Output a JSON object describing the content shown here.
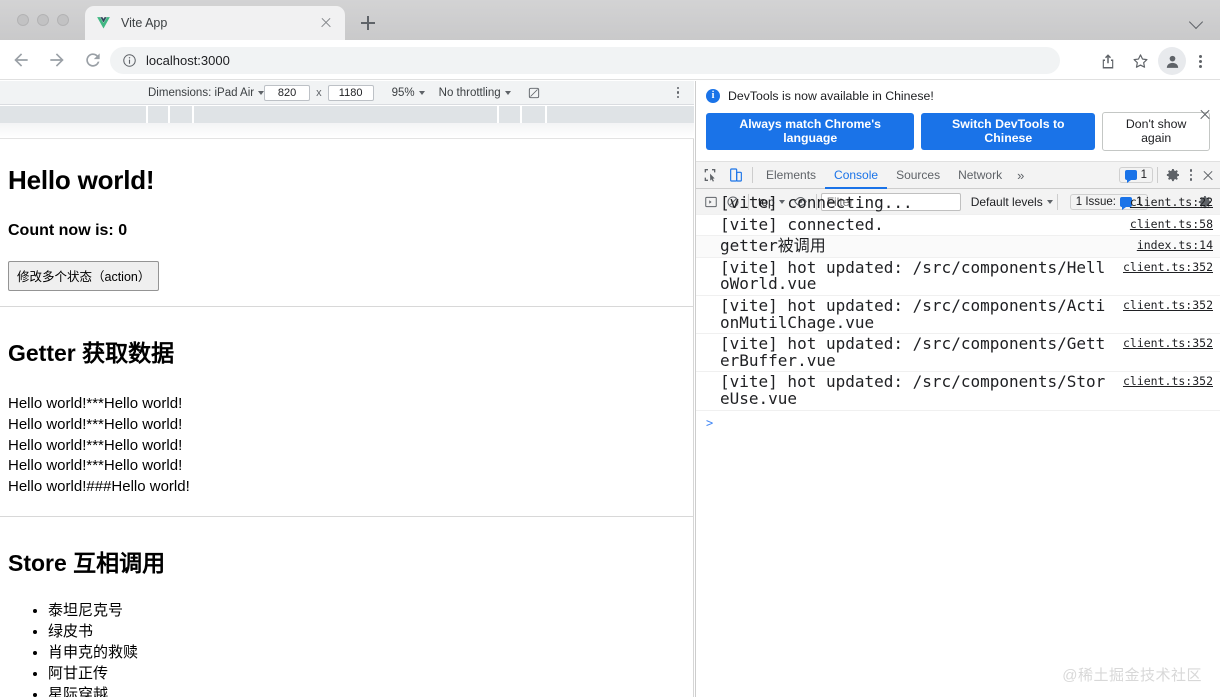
{
  "browser": {
    "tab": {
      "title": "Vite App",
      "favicon": "vue-logo-icon"
    },
    "new_tab_label": "+",
    "omnibox": {
      "url": "localhost:3000",
      "security_icon": "info-circle-icon"
    },
    "nav": {
      "back": "back-arrow-icon",
      "forward": "forward-arrow-icon",
      "reload": "reload-icon"
    },
    "actions": {
      "share": "share-icon",
      "bookmark": "star-icon",
      "profile": "avatar-icon",
      "menu": "kebab-menu-icon"
    }
  },
  "device_toolbar": {
    "dimensions_label": "Dimensions: iPad Air",
    "width": "820",
    "height": "1180",
    "multiply": "x",
    "zoom": "95%",
    "throttling": "No throttling",
    "rotate_icon": "rotate-icon",
    "more_icon": "kebab-menu-icon"
  },
  "page": {
    "title": "Hello world!",
    "count_text": "Count now is: 0",
    "action_button": "修改多个状态（action）",
    "getter_heading": "Getter 获取数据",
    "getter_lines": [
      "Hello world!***Hello world!",
      "Hello world!***Hello world!",
      "Hello world!***Hello world!",
      "Hello world!***Hello world!",
      "Hello world!###Hello world!"
    ],
    "store_heading": "Store 互相调用",
    "movies": [
      "泰坦尼克号",
      "绿皮书",
      "肖申克的救赎",
      "阿甘正传",
      "星际穿越"
    ]
  },
  "watermark": "@稀土掘金技术社区",
  "devtools": {
    "banner": {
      "message": "DevTools is now available in Chinese!",
      "primary_button": "Always match Chrome's language",
      "secondary_button": "Switch DevTools to Chinese",
      "tertiary_button": "Don't show again",
      "close_icon": "close-icon",
      "info_icon": "info-icon",
      "info_glyph": "i"
    },
    "toolbar": {
      "inspect_icon": "inspect-element-icon",
      "device_toggle_icon": "device-toolbar-icon",
      "tabs": [
        {
          "label": "Elements",
          "active": false
        },
        {
          "label": "Console",
          "active": true
        },
        {
          "label": "Sources",
          "active": false
        },
        {
          "label": "Network",
          "active": false
        }
      ],
      "overflow": "»",
      "issues_count": "1",
      "settings_icon": "gear-icon",
      "more_icon": "kebab-menu-icon",
      "close_icon": "close-icon"
    },
    "filterbar": {
      "sidebar_icon": "console-sidebar-icon",
      "clear_icon": "clear-console-icon",
      "context": "top",
      "eye_icon": "live-expression-icon",
      "filter_placeholder": "Filter",
      "filter_value": "",
      "levels": "Default levels",
      "issues_label": "1 Issue:",
      "issues_count": "1",
      "settings_icon": "gear-icon"
    },
    "logs": [
      {
        "text": "[vite] connecting...",
        "source": "client.ts:22"
      },
      {
        "text": "[vite] connected.",
        "source": "client.ts:58"
      },
      {
        "text": "getter被调用",
        "source": "index.ts:14"
      },
      {
        "text": "[vite] hot updated: /src/components/HelloWorld.vue",
        "source": "client.ts:352"
      },
      {
        "text": "[vite] hot updated: /src/components/ActionMutilChage.vue",
        "source": "client.ts:352"
      },
      {
        "text": "[vite] hot updated: /src/components/GetterBuffer.vue",
        "source": "client.ts:352"
      },
      {
        "text": "[vite] hot updated: /src/components/StoreUse.vue",
        "source": "client.ts:352"
      }
    ],
    "prompt": ">"
  },
  "colors": {
    "accent_blue": "#1a73e8",
    "vue_green": "#42b883",
    "toolbar_bg": "#f3f3f3"
  }
}
